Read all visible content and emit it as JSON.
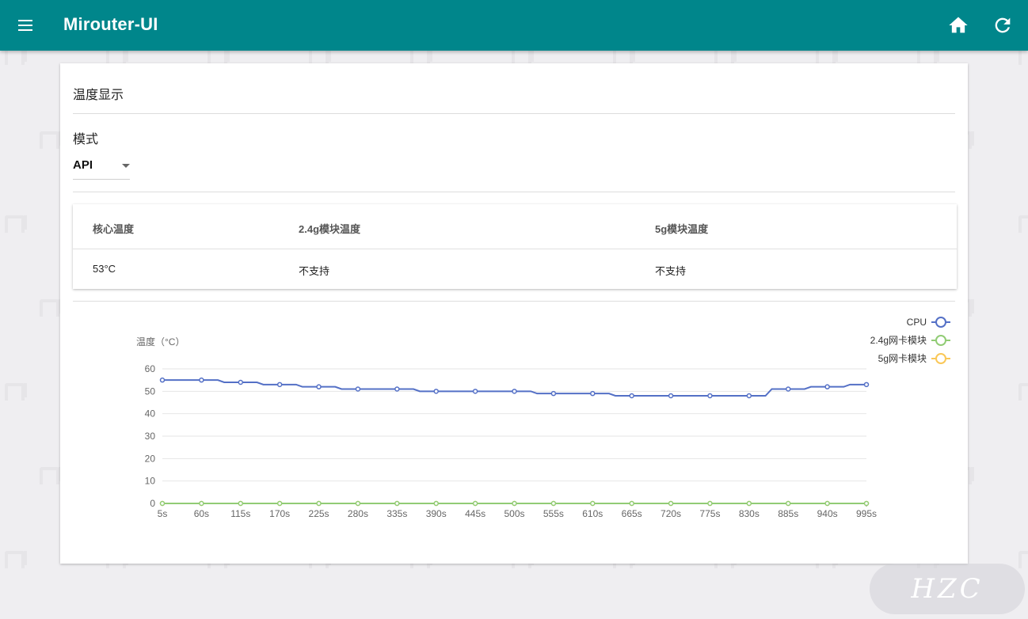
{
  "app": {
    "title": "Mirouter-UI",
    "accent": "#00868b"
  },
  "card": {
    "title": "温度显示",
    "mode_label": "模式",
    "mode_value": "API"
  },
  "table": {
    "headers": [
      "核心温度",
      "2.4g模块温度",
      "5g模块温度"
    ],
    "values": [
      "53°C",
      "不支持",
      "不支持"
    ]
  },
  "badge": {
    "text": "HZC"
  },
  "chart_data": {
    "type": "line",
    "ylabel": "温度（°C）",
    "ylim": [
      0,
      60
    ],
    "yticks": [
      0,
      10,
      20,
      30,
      40,
      50,
      60
    ],
    "grid": true,
    "legend_position": "top-right",
    "x": [
      "5s",
      "60s",
      "115s",
      "170s",
      "225s",
      "280s",
      "335s",
      "390s",
      "445s",
      "500s",
      "555s",
      "610s",
      "665s",
      "720s",
      "775s",
      "830s",
      "885s",
      "940s",
      "995s"
    ],
    "series": [
      {
        "name": "CPU",
        "color": "#5470c6",
        "values": [
          55,
          55,
          54,
          53,
          52,
          51,
          51,
          50,
          50,
          50,
          49,
          49,
          48,
          48,
          48,
          48,
          51,
          52,
          53
        ]
      },
      {
        "name": "2.4g网卡模块",
        "color": "#91cc75",
        "values": [
          0,
          0,
          0,
          0,
          0,
          0,
          0,
          0,
          0,
          0,
          0,
          0,
          0,
          0,
          0,
          0,
          0,
          0,
          0
        ]
      },
      {
        "name": "5g网卡模块",
        "color": "#fac858",
        "values": [
          0,
          0,
          0,
          0,
          0,
          0,
          0,
          0,
          0,
          0,
          0,
          0,
          0,
          0,
          0,
          0,
          0,
          0,
          0
        ]
      }
    ]
  }
}
